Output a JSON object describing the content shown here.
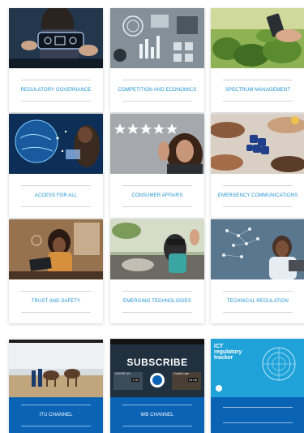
{
  "cards": [
    {
      "label": "Regulatory Governance"
    },
    {
      "label": "Competition and Economics"
    },
    {
      "label": "Spectrum Management"
    },
    {
      "label": "Access for All"
    },
    {
      "label": "Consumer Affairs"
    },
    {
      "label": "Emergency Communications"
    },
    {
      "label": "Trust and Safety"
    },
    {
      "label": "Emerging Technologies"
    },
    {
      "label": "Technical Regulation"
    }
  ],
  "channels": [
    {
      "label": "ITU Channel"
    },
    {
      "label": "WB Channel",
      "overlay_title": "SUBSCRIBE",
      "chip_left": "COVID-19",
      "chip_right": "Covid Law",
      "time_left": "1:32",
      "time_right": "24:06"
    },
    {
      "label": "",
      "overlay_lines": [
        "ICT",
        "regulatory",
        "tracker"
      ]
    }
  ],
  "colors": {
    "accent": "#1f92d3",
    "channel_bar": "#0a63b5"
  }
}
